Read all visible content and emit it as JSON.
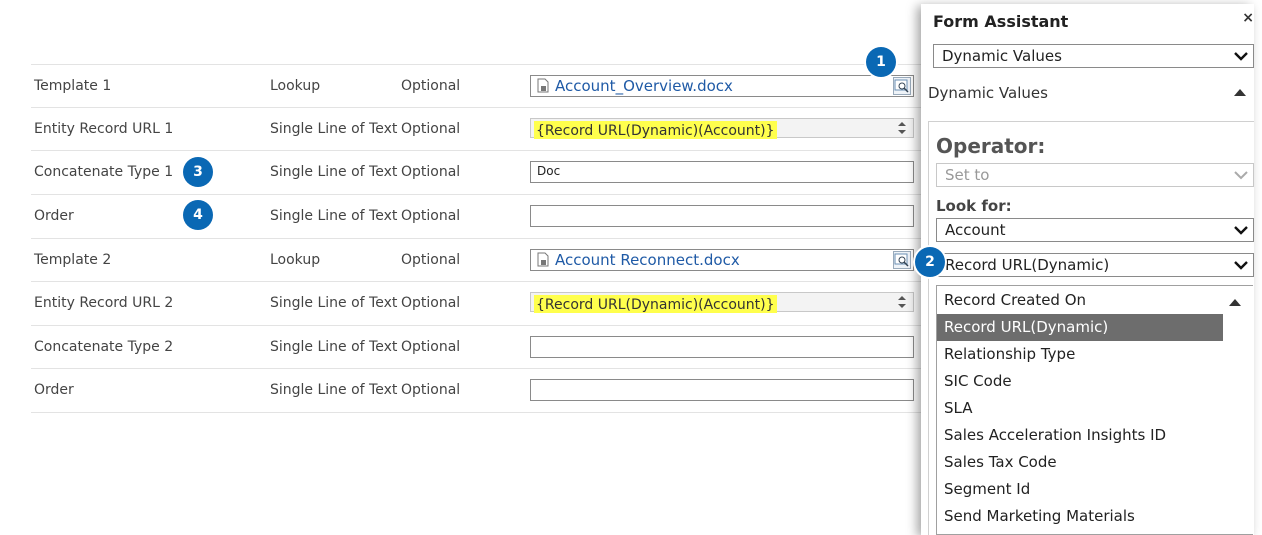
{
  "form": {
    "rows": [
      {
        "name": "Template 1",
        "type": "Lookup",
        "req": "Optional",
        "value": "Account_Overview.docx",
        "kind": "lookup"
      },
      {
        "name": "Entity Record URL 1",
        "type": "Single Line of Text",
        "req": "Optional",
        "value": "{Record URL(Dynamic)(Account)}",
        "kind": "dynamic"
      },
      {
        "name": "Concatenate Type 1",
        "type": "Single Line of Text",
        "req": "Optional",
        "value": "Doc",
        "kind": "text"
      },
      {
        "name": "Order",
        "type": "Single Line of Text",
        "req": "Optional",
        "value": "",
        "kind": "text"
      },
      {
        "name": "Template 2",
        "type": "Lookup",
        "req": "Optional",
        "value": "Account Reconnect.docx",
        "kind": "lookup"
      },
      {
        "name": "Entity Record URL 2",
        "type": "Single Line of Text",
        "req": "Optional",
        "value": "{Record URL(Dynamic)(Account)}",
        "kind": "dynamic"
      },
      {
        "name": "Concatenate Type 2",
        "type": "Single Line of Text",
        "req": "Optional",
        "value": "",
        "kind": "text"
      },
      {
        "name": "Order",
        "type": "Single Line of Text",
        "req": "Optional",
        "value": "",
        "kind": "text"
      }
    ]
  },
  "badges": [
    "1",
    "2",
    "3",
    "4"
  ],
  "assistant": {
    "title": "Form Assistant",
    "close": "×",
    "mode": "Dynamic Values",
    "section": "Dynamic Values",
    "operator_label": "Operator:",
    "operator_value": "Set to",
    "look_for_label": "Look for:",
    "look_for_value": "Account",
    "attribute_value": "Record URL(Dynamic)",
    "list": [
      "Record Created On",
      "Record URL(Dynamic)",
      "Relationship Type",
      "SIC Code",
      "SLA",
      "Sales Acceleration Insights ID",
      "Sales Tax Code",
      "Segment Id",
      "Send Marketing Materials"
    ],
    "selected_index": 1
  },
  "colors": {
    "accent": "#0a68b4",
    "highlight": "#ffff4d",
    "link": "#1f5aa6",
    "selected": "#6d6d6d"
  }
}
